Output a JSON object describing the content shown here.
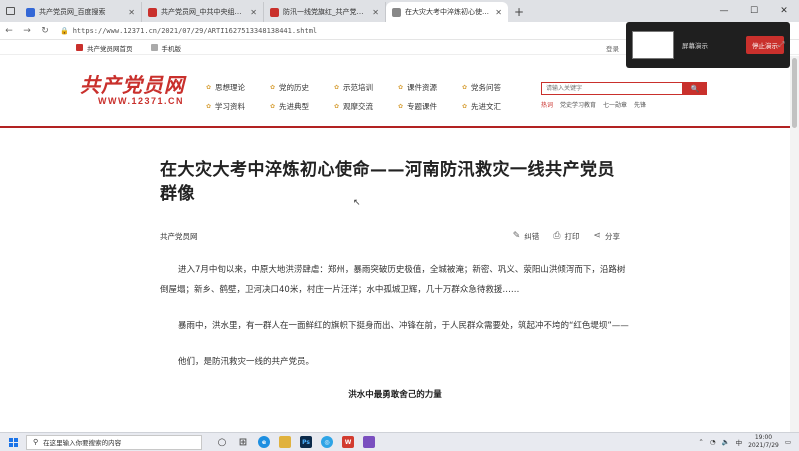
{
  "browser": {
    "tabs": [
      {
        "title": "共产党员网_百度搜索",
        "favicon_color": "#3367d6",
        "active": false
      },
      {
        "title": "共产党员网_中共中央组织部",
        "favicon_color": "#c9302c",
        "active": false
      },
      {
        "title": "防汛一线党旗红_共产党员网",
        "favicon_color": "#c9302c",
        "active": false
      },
      {
        "title": "在大灾大考中淬炼初心使命——",
        "favicon_color": "#888888",
        "active": true
      }
    ],
    "new_tab": "+",
    "window_controls": {
      "minimize": "—",
      "maximize": "☐",
      "close": "✕"
    },
    "url": "https://www.12371.cn/2021/07/29/ARTI1627513348138441.shtml",
    "bookmarks": [
      "共产党员网首页",
      "手机版"
    ],
    "bookmarks_right": "登录"
  },
  "screen_share": {
    "label": "屏幕演示",
    "stop_label": "停止演示"
  },
  "site": {
    "logo_cn": "共产党员网",
    "logo_en": "WWW.12371.CN",
    "nav": [
      "思想理论",
      "党的历史",
      "示范培训",
      "课件资源",
      "党务问答",
      "学习资料",
      "先进典型",
      "观摩交流",
      "专题课件",
      "先进文汇"
    ],
    "search_placeholder": "请输入关键字",
    "search_button": "🔍",
    "hot_words": [
      "热词",
      "党史学习教育",
      "七一勋章",
      "先锋"
    ]
  },
  "article": {
    "title": "在大灾大考中淬炼初心使命——河南防汛救灾一线共产党员群像",
    "source": "共产党员网",
    "tools": [
      "纠错",
      "打印",
      "分享"
    ],
    "paragraphs": [
      "进入7月中旬以来，中原大地洪涝肆虐：郑州，暴雨突破历史极值，全城被淹；新密、巩义、荥阳山洪倾泻而下，沿路树倒屋塌；新乡、鹤壁，卫河决口40米，村庄一片汪洋；水中孤城卫辉，几十万群众急待救援……",
      "暴雨中，洪水里，有一群人在一面鲜红的旗帜下挺身而出、冲锋在前，于人民群众需要处，筑起冲不垮的“红色堤坝”——",
      "他们，是防汛救灾一线的共产党员。"
    ],
    "subheading": "洪水中最勇敢舍己的力量"
  },
  "taskbar": {
    "search_placeholder": "在这里输入你要搜索的内容",
    "time": "19:00",
    "date": "2021/7/29",
    "app_icons": [
      {
        "name": "task-view",
        "color": "#444444",
        "glyph": "○"
      },
      {
        "name": "multitask",
        "color": "#555555",
        "glyph": "⊞"
      },
      {
        "name": "edge",
        "color": "#1d8fe1",
        "glyph": "e"
      },
      {
        "name": "files",
        "color": "#e0b23e",
        "glyph": ""
      },
      {
        "name": "photoshop",
        "color": "#0b2a4a",
        "glyph": "Ps"
      },
      {
        "name": "browser-360",
        "color": "#2ea4e6",
        "glyph": "◎"
      },
      {
        "name": "wps",
        "color": "#d23b2f",
        "glyph": "W"
      },
      {
        "name": "misc",
        "color": "#7a4fbf",
        "glyph": ""
      }
    ]
  }
}
